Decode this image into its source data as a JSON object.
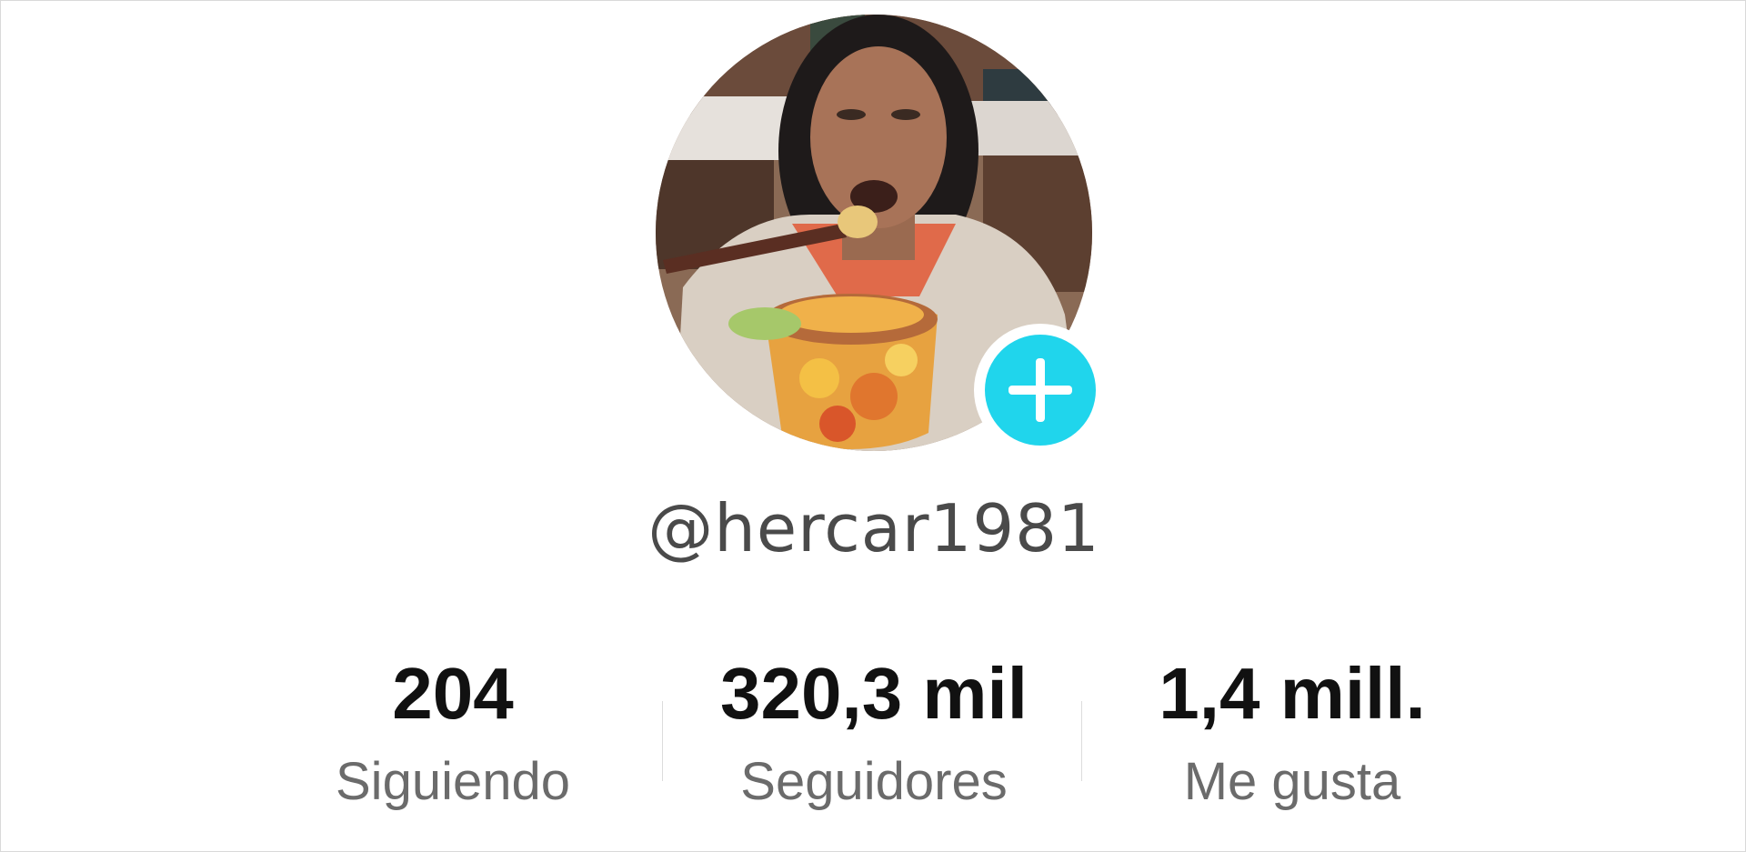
{
  "profile": {
    "username": "@hercar1981"
  },
  "stats": [
    {
      "value": "204",
      "label": "Siguiendo"
    },
    {
      "value": "320,3 mil",
      "label": "Seguidores"
    },
    {
      "value": "1,4 mill.",
      "label": "Me gusta"
    }
  ],
  "icons": {
    "follow": "plus-icon"
  },
  "colors": {
    "accent": "#20d5ec",
    "username": "#4a4a4a",
    "stat_value": "#111111",
    "stat_label": "#6b6b6b"
  }
}
